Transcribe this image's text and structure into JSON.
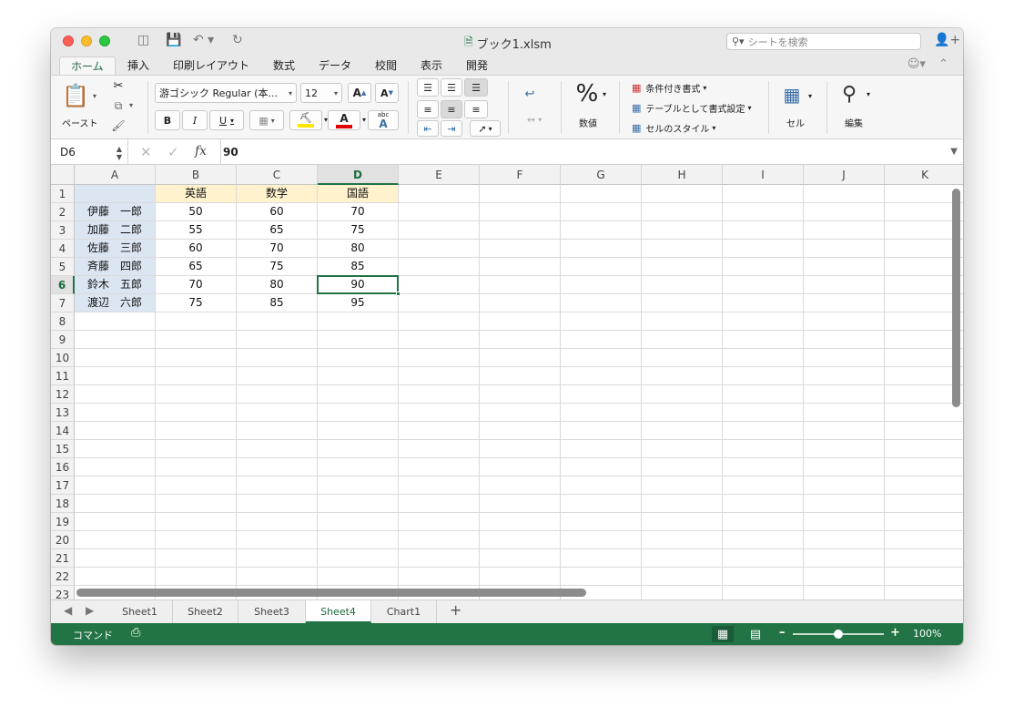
{
  "window": {
    "title": "ブック1.xlsm"
  },
  "search": {
    "placeholder": "シートを検索"
  },
  "tabs": [
    "ホーム",
    "挿入",
    "印刷レイアウト",
    "数式",
    "データ",
    "校閲",
    "表示",
    "開発"
  ],
  "ribbon": {
    "paste_label": "ペースト",
    "font_name": "游ゴシック Regular (本...",
    "font_size": "12",
    "bold": "B",
    "italic": "I",
    "underline": "U",
    "number_label": "数値",
    "percent_symbol": "%",
    "cond_format": "条件付き書式",
    "table_format": "テーブルとして書式設定",
    "cell_style": "セルのスタイル",
    "cells_label": "セル",
    "edit_label": "編集"
  },
  "formula_bar": {
    "name_box": "D6",
    "fx": "fx",
    "value": "90"
  },
  "columns": [
    "A",
    "B",
    "C",
    "D",
    "E",
    "F",
    "G",
    "H",
    "I",
    "J",
    "K"
  ],
  "selected_column": "D",
  "rows": [
    "1",
    "2",
    "3",
    "4",
    "5",
    "6",
    "7",
    "8",
    "9",
    "10",
    "11",
    "12",
    "13",
    "14",
    "15",
    "16",
    "17",
    "18",
    "19",
    "20",
    "21",
    "22",
    "23"
  ],
  "selected_row": "6",
  "table": {
    "headers": [
      "英語",
      "数学",
      "国語"
    ],
    "names": [
      "伊藤　一郎",
      "加藤　二郎",
      "佐藤　三郎",
      "斉藤　四郎",
      "鈴木　五郎",
      "渡辺　六郎"
    ],
    "values": [
      [
        "50",
        "60",
        "70"
      ],
      [
        "55",
        "65",
        "75"
      ],
      [
        "60",
        "70",
        "80"
      ],
      [
        "65",
        "75",
        "85"
      ],
      [
        "70",
        "80",
        "90"
      ],
      [
        "75",
        "85",
        "95"
      ]
    ]
  },
  "sheets": [
    "Sheet1",
    "Sheet2",
    "Sheet3",
    "Sheet4",
    "Chart1"
  ],
  "active_sheet": "Sheet4",
  "status": {
    "mode": "コマンド",
    "zoom": "100%"
  },
  "colors": {
    "accent": "#217346",
    "header_fill": "#fff2cc",
    "name_fill": "#dce6f2"
  }
}
